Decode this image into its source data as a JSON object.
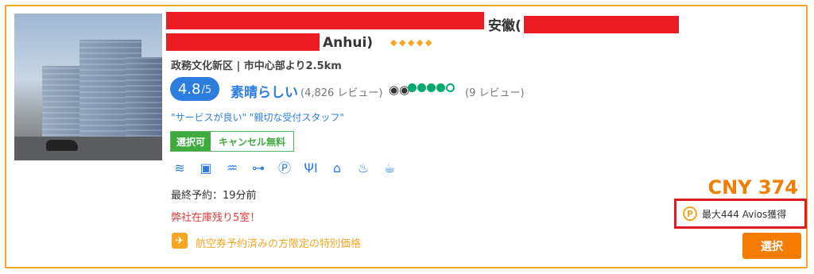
{
  "hotel": {
    "name_part1": "安徽(",
    "name_part2": "Anhui)",
    "star_count": 5,
    "location": "政務文化新区 | 市中心部より2.5km",
    "score": "4.8",
    "score_max": "/5",
    "rating_word": "素晴らしい",
    "review_count": "(4,826 レビュー)",
    "tripadvisor_reviews": "(9 レビュー)",
    "tripadvisor_rating": 4,
    "highlights": "\"サービスが良い\" \"親切な受付スタッフ\"",
    "tag_selectable": "選択可",
    "tag_free_cancel": "キャンセル無料",
    "last_booking": "最終予約：19分前",
    "rooms_left": "弊社在庫残り5室！",
    "special_price": "航空券予約済みの方限定の特別価格"
  },
  "amenities": [
    {
      "name": "wifi-icon",
      "glyph": "📶"
    },
    {
      "name": "bus-icon",
      "glyph": "🚌"
    },
    {
      "name": "pool-icon",
      "glyph": "♒"
    },
    {
      "name": "gym-icon",
      "glyph": "⊶"
    },
    {
      "name": "parking-icon",
      "glyph": "Ⓟ"
    },
    {
      "name": "restaurant-icon",
      "glyph": "🍴"
    },
    {
      "name": "front-desk-24h-icon",
      "glyph": "🛎"
    },
    {
      "name": "spa-icon",
      "glyph": "♨"
    },
    {
      "name": "coffee-icon",
      "glyph": "☕"
    }
  ],
  "pricing": {
    "price": "CNY 374",
    "avios": "最大444 Avios獲得",
    "select_label": "選択"
  },
  "colors": {
    "accent": "#f5a623",
    "primary_blue": "#2d7de0",
    "price_orange": "#f07e00",
    "button_orange": "#f57c00",
    "redaction": "#ec1c24",
    "urgent_red": "#e23a3a",
    "tag_green": "#3fab3f"
  }
}
